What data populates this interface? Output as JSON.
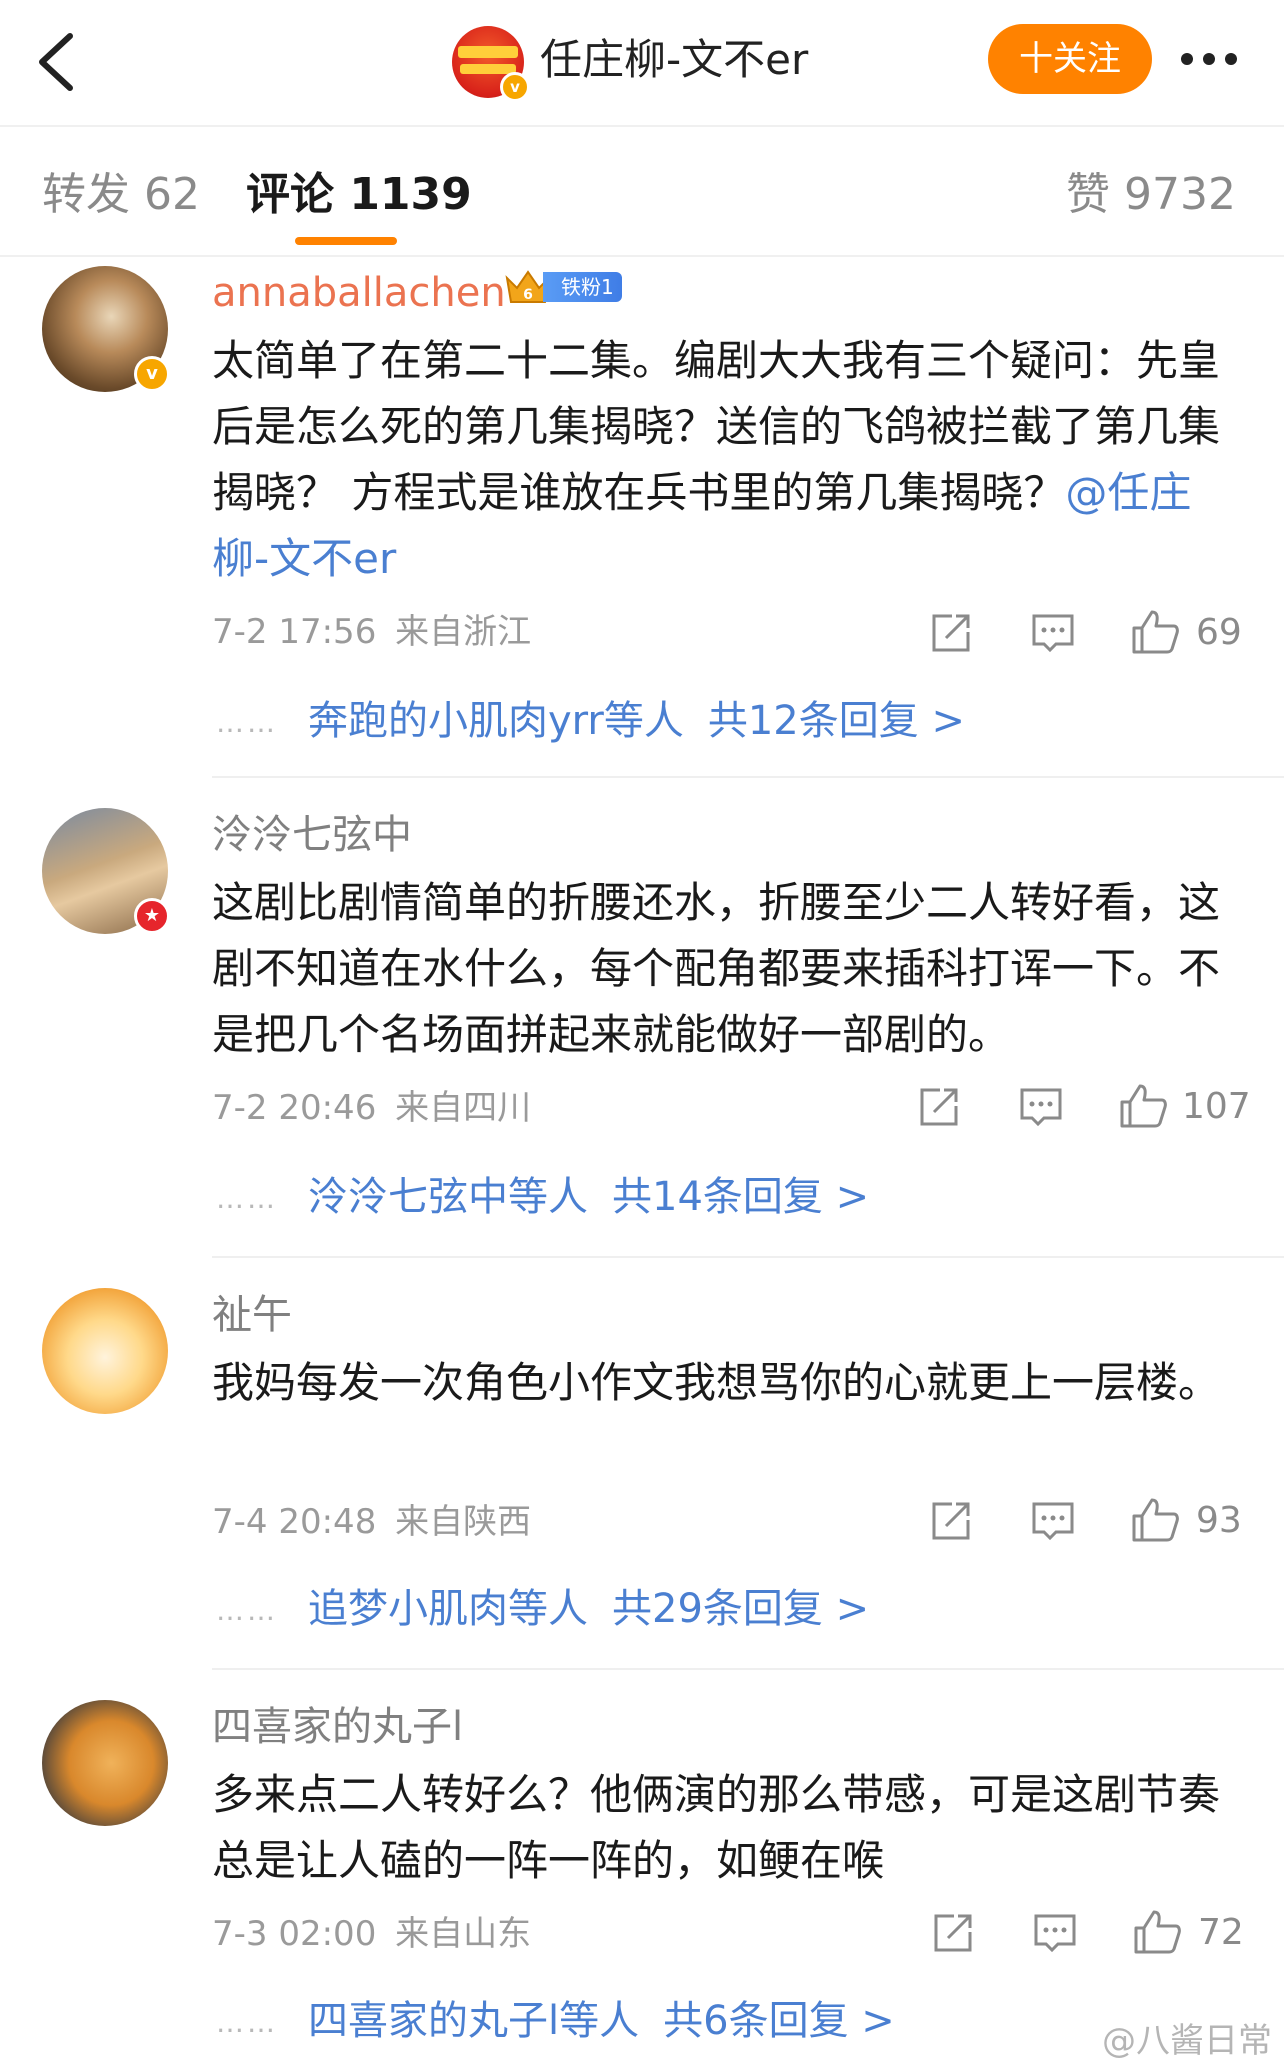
{
  "header": {
    "title": "任庄柳-文不er",
    "follow_label": "十关注"
  },
  "tabs": {
    "repost": "转发 62",
    "comment": "评论 1139",
    "like": "赞 9732"
  },
  "comments": [
    {
      "username": "annaballachen",
      "fan_badge": "铁粉1",
      "fan_level": "6",
      "content": "太简单了在第二十二集。编剧大大我有三个疑问：先皇后是怎么死的第几集揭晓？送信的飞鸽被拦截了第几集揭晓？ 方程式是谁放在兵书里的第几集揭晓？",
      "mention": "@任庄柳-文不er",
      "time": "7-2 17:56",
      "location": "来自浙江",
      "likes": "69",
      "reply_names": "奔跑的小肌肉yrr",
      "reply_etc": "等人",
      "reply_total": "共12条回复 >"
    },
    {
      "username": "泠泠七弦中",
      "content": "这剧比剧情简单的折腰还水，折腰至少二人转好看，这剧不知道在水什么，每个配角都要来插科打诨一下。不是把几个名场面拼起来就能做好一部剧的。",
      "time": "7-2 20:46",
      "location": "来自四川",
      "likes": "107",
      "reply_names": "泠泠七弦中",
      "reply_etc": "等人",
      "reply_total": "共14条回复 >"
    },
    {
      "username": "祉午",
      "content": "我妈每发一次角色小作文我想骂你的心就更上一层楼。",
      "time": "7-4 20:48",
      "location": "来自陕西",
      "likes": "93",
      "reply_names": "追梦小肌肉",
      "reply_etc": "等人",
      "reply_total": "共29条回复 >"
    },
    {
      "username": "四喜家的丸子l",
      "content": "多来点二人转好么？他俩演的那么带感，可是这剧节奏总是让人磕的一阵一阵的，如鲠在喉",
      "time": "7-3 02:00",
      "location": "来自山东",
      "likes": "72",
      "reply_names": "四喜家的丸子l",
      "reply_etc": "等人",
      "reply_total": "共6条回复 >"
    }
  ],
  "dots": "……",
  "watermark": "@八酱日常",
  "colors": {
    "accent": "#ff8200",
    "link": "#4a7fd1",
    "username_orange": "#eb7350"
  }
}
